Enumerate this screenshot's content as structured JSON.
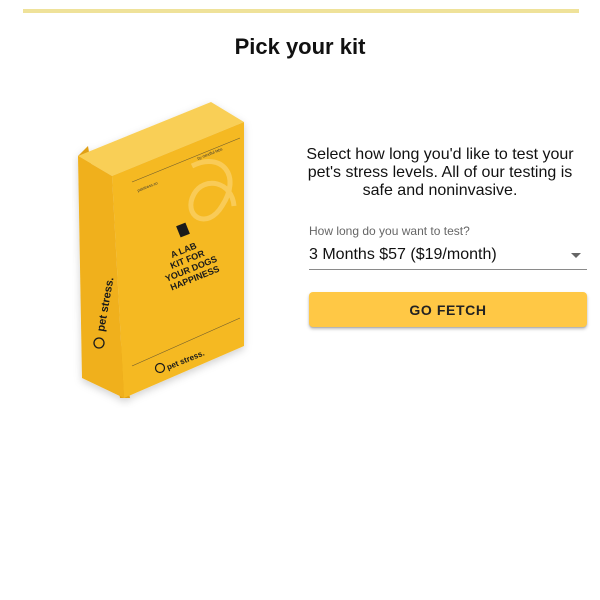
{
  "progress": {
    "fraction": 1.0
  },
  "header": {
    "title": "Pick your kit"
  },
  "product": {
    "box_headline_lines": [
      "A LAB",
      "KIT FOR",
      "YOUR DOGS",
      "HAPPINESS"
    ],
    "brand": "pet stress.",
    "top_left_text": "petstress.co",
    "top_right_text": "by mindful labs"
  },
  "form": {
    "description": "Select how long you'd like to test your pet's stress levels. All of our testing is safe and noninvasive.",
    "duration_label": "How long do you want to test?",
    "duration_value": "3 Months $57 ($19/month)",
    "submit_label": "GO FETCH"
  },
  "colors": {
    "accent": "#ffc845",
    "box_front": "#f5b923",
    "box_side": "#e7a716",
    "box_top": "#fad15a",
    "progress": "#efe29a"
  }
}
